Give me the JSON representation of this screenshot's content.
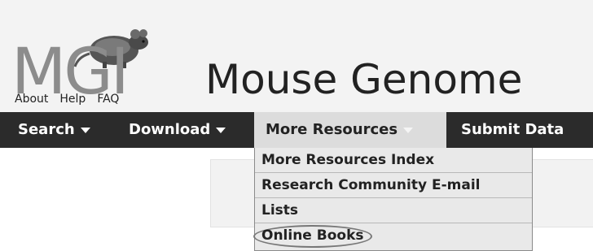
{
  "logo": {
    "text": "MGI",
    "icon": "mouse-icon"
  },
  "logo_links": [
    "About",
    "Help",
    "FAQ"
  ],
  "site_title": "Mouse Genome",
  "nav": {
    "items": [
      {
        "label": "Search",
        "has_caret": true
      },
      {
        "label": "Download",
        "has_caret": true
      },
      {
        "label": "More Resources",
        "has_caret": true,
        "active": true
      },
      {
        "label": "Submit Data",
        "has_caret": false
      }
    ]
  },
  "dropdown": {
    "items": [
      {
        "label": "More Resources Index"
      },
      {
        "label": "Research Community E-mail"
      },
      {
        "label": "Lists"
      },
      {
        "label": "Online Books",
        "highlighted": true
      }
    ]
  },
  "colors": {
    "nav_bg": "#2b2b2b",
    "active_tab_bg": "#dcdcdc",
    "dropdown_bg": "#e9e9e9",
    "header_bg": "#f3f3f3"
  }
}
